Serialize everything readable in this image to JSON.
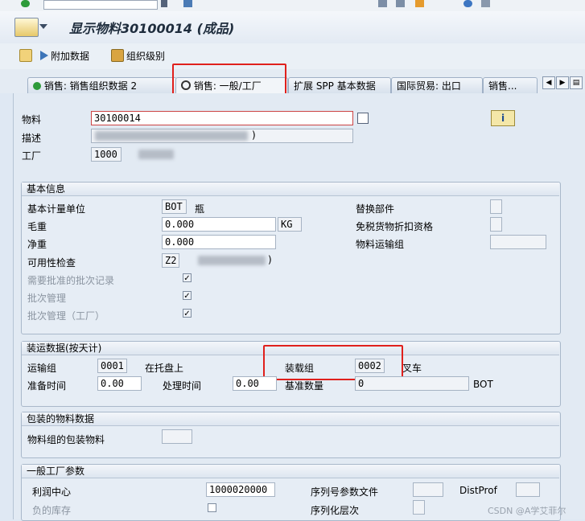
{
  "window": {
    "title": "显示物料30100014 (成品)"
  },
  "toolbar": {
    "additional_data": "附加数据",
    "org_levels": "组织级别"
  },
  "tabs": [
    {
      "label": "销售: 销售组织数据 2"
    },
    {
      "label": "销售: 一般/工厂"
    },
    {
      "label": "扩展 SPP 基本数据"
    },
    {
      "label": "国际贸易: 出口"
    },
    {
      "label": "销售..."
    }
  ],
  "header": {
    "material_label": "物料",
    "material_value": "30100014",
    "desc_label": "描述",
    "desc_suffix": ")",
    "plant_label": "工厂",
    "plant_value": "1000"
  },
  "basic": {
    "title": "基本信息",
    "base_uom_label": "基本计量单位",
    "base_uom_value": "BOT",
    "base_uom_text": "瓶",
    "gross_weight_label": "毛重",
    "gross_weight_value": "0.000",
    "weight_unit": "KG",
    "net_weight_label": "净重",
    "net_weight_value": "0.000",
    "availability_check_label": "可用性检查",
    "availability_check_value": "Z2",
    "availability_check_suffix": ")",
    "batch_records_label": "需要批准的批次记录",
    "batch_mgmt_label": "批次管理",
    "batch_mgmt_plant_label": "批次管理（工厂）",
    "replacement_part_label": "替换部件",
    "tax_discount_label": "免税货物折扣资格",
    "mat_freight_group_label": "物料运输组"
  },
  "shipping": {
    "title": "装运数据(按天计)",
    "trans_group_label": "运输组",
    "trans_group_value": "0001",
    "trans_group_text": "在托盘上",
    "loading_group_label": "装载组",
    "loading_group_value": "0002",
    "loading_group_text": "叉车",
    "setup_time_label": "准备时间",
    "setup_time_value": "0.00",
    "proc_time_label": "处理时间",
    "proc_time_value": "0.00",
    "base_qty_label": "基准数量",
    "base_qty_value": "0",
    "base_qty_unit": "BOT"
  },
  "packaging": {
    "title": "包装的物料数据",
    "mat_group_pack_label": "物料组的包装物料"
  },
  "general_plant": {
    "title": "一般工厂参数",
    "profit_center_label": "利润中心",
    "profit_center_value": "1000020000",
    "serial_profile_label": "序列号参数文件",
    "distprof_label": "DistProf",
    "neg_stock_label": "负的库存",
    "serialization_label": "序列化层次"
  },
  "watermark": "CSDN @A学艾菲尔",
  "colors": {
    "highlight": "#e0201c",
    "panel_bg": "#e2eaf3"
  }
}
